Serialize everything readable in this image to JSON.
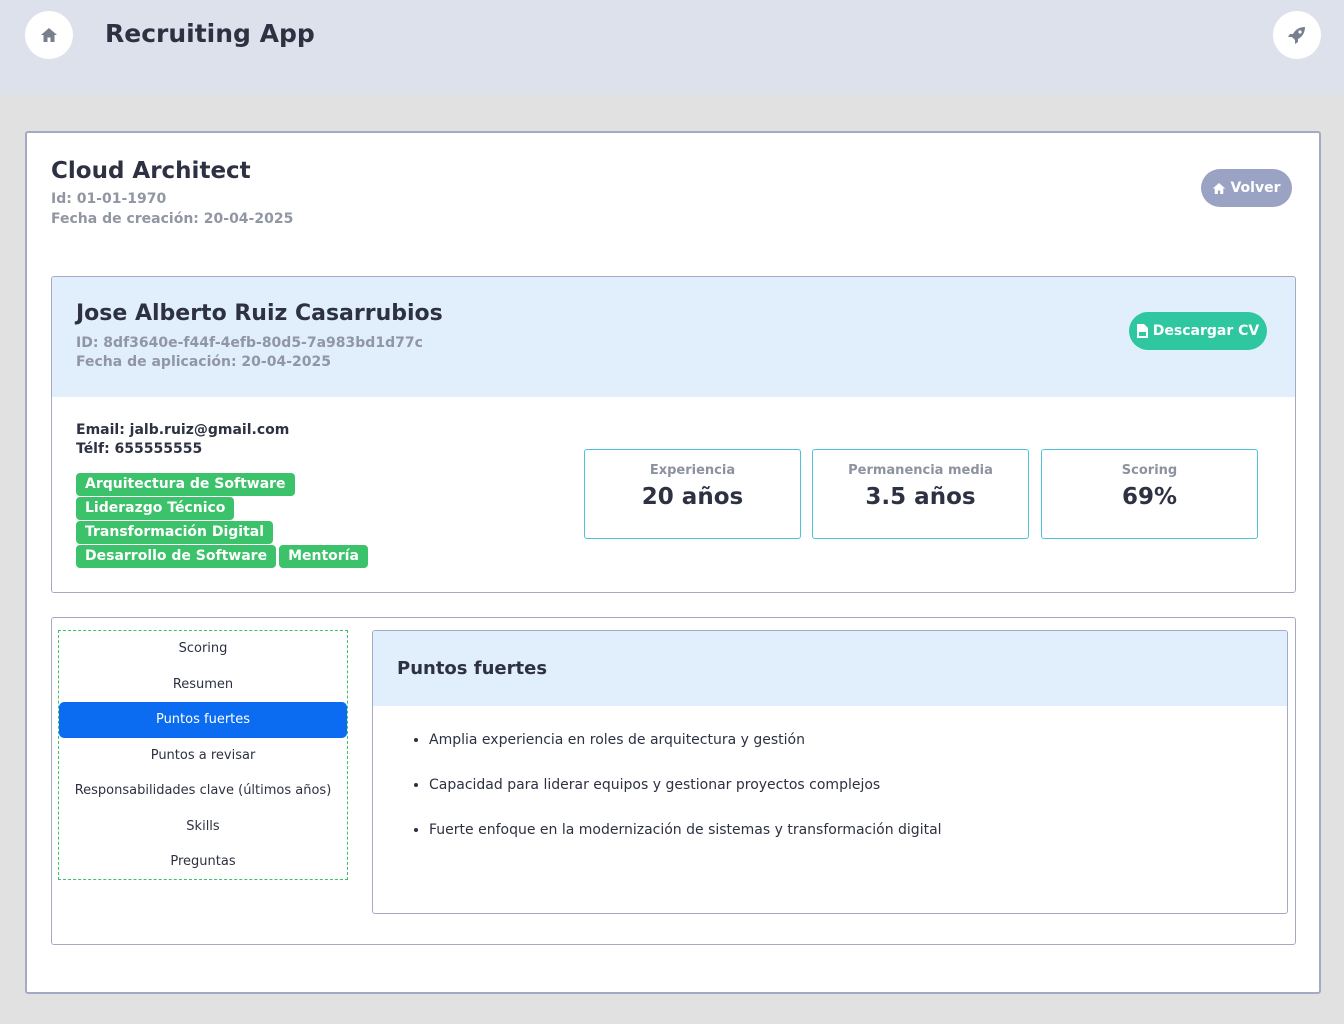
{
  "header": {
    "app_title": "Recruiting App",
    "home_icon": "home-icon",
    "rocket_icon": "rocket-icon"
  },
  "job": {
    "title": "Cloud Architect",
    "id_text": "Id: 01-01-1970",
    "date_text": "Fecha de creación: 20-04-2025",
    "back_label": "Volver"
  },
  "candidate": {
    "name": "Jose Alberto Ruiz Casarrubios",
    "id_text": "ID: 8df3640e-f44f-4efb-80d5-7a983bd1d77c",
    "date_text": "Fecha de aplicación: 20-04-2025",
    "download_label": "Descargar CV",
    "email_text": "Email: jalb.ruiz@gmail.com",
    "phone_text": "Télf: 655555555",
    "tags": [
      "Arquitectura de Software",
      "Liderazgo Técnico",
      "Transformación Digital",
      "Desarrollo de Software",
      "Mentoría"
    ],
    "stats": [
      {
        "label": "Experiencia",
        "value": "20 años"
      },
      {
        "label": "Permanencia media",
        "value": "3.5 años"
      },
      {
        "label": "Scoring",
        "value": "69%"
      }
    ]
  },
  "sections": {
    "nav": [
      "Scoring",
      "Resumen",
      "Puntos fuertes",
      "Puntos a revisar",
      "Responsabilidades clave (últimos años)",
      "Skills",
      "Preguntas"
    ],
    "active": "Puntos fuertes",
    "panel_title": "Puntos fuertes",
    "items": [
      "Amplia experiencia en roles de arquitectura y gestión",
      "Capacidad para liderar equipos y gestionar proyectos complejos",
      "Fuerte enfoque en la modernización de sistemas y transformación digital"
    ]
  },
  "colors": {
    "accent": "#0b6cf2",
    "tag": "#3cc26a",
    "cv_button": "#2fc7a0",
    "back_button": "#9aa3c3"
  }
}
